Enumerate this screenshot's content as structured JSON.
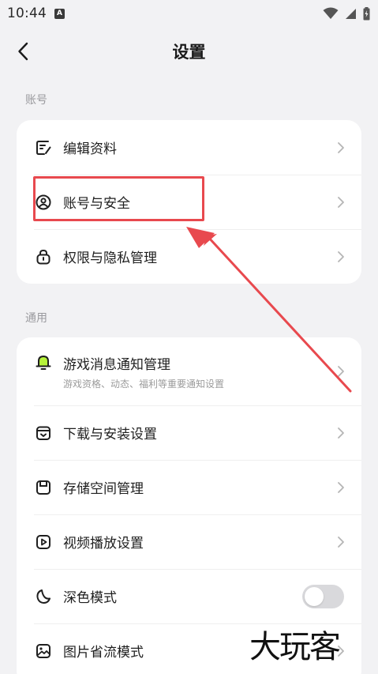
{
  "status_bar": {
    "time": "10:44",
    "badge": "A"
  },
  "nav": {
    "title": "设置"
  },
  "sections": {
    "account": {
      "label": "账号",
      "items": [
        {
          "label": "编辑资料",
          "icon": "edit-profile-icon"
        },
        {
          "label": "账号与安全",
          "icon": "account-security-icon"
        },
        {
          "label": "权限与隐私管理",
          "icon": "privacy-lock-icon"
        }
      ]
    },
    "general": {
      "label": "通用",
      "items": [
        {
          "label": "游戏消息通知管理",
          "sub": "游戏资格、动态、福利等重要通知设置",
          "icon": "bell-icon"
        },
        {
          "label": "下载与安装设置",
          "icon": "download-box-icon"
        },
        {
          "label": "存储空间管理",
          "icon": "storage-icon"
        },
        {
          "label": "视频播放设置",
          "icon": "video-play-icon"
        },
        {
          "label": "深色模式",
          "icon": "moon-icon",
          "toggle": false
        },
        {
          "label": "图片省流模式",
          "icon": "image-icon"
        }
      ]
    }
  },
  "watermark": "大玩客",
  "colors": {
    "background": "#f2f2f4",
    "card": "#ffffff",
    "annotation": "#e8494e",
    "bell_accent": "#b6f23a",
    "toggle_off": "#d9d9dc"
  }
}
